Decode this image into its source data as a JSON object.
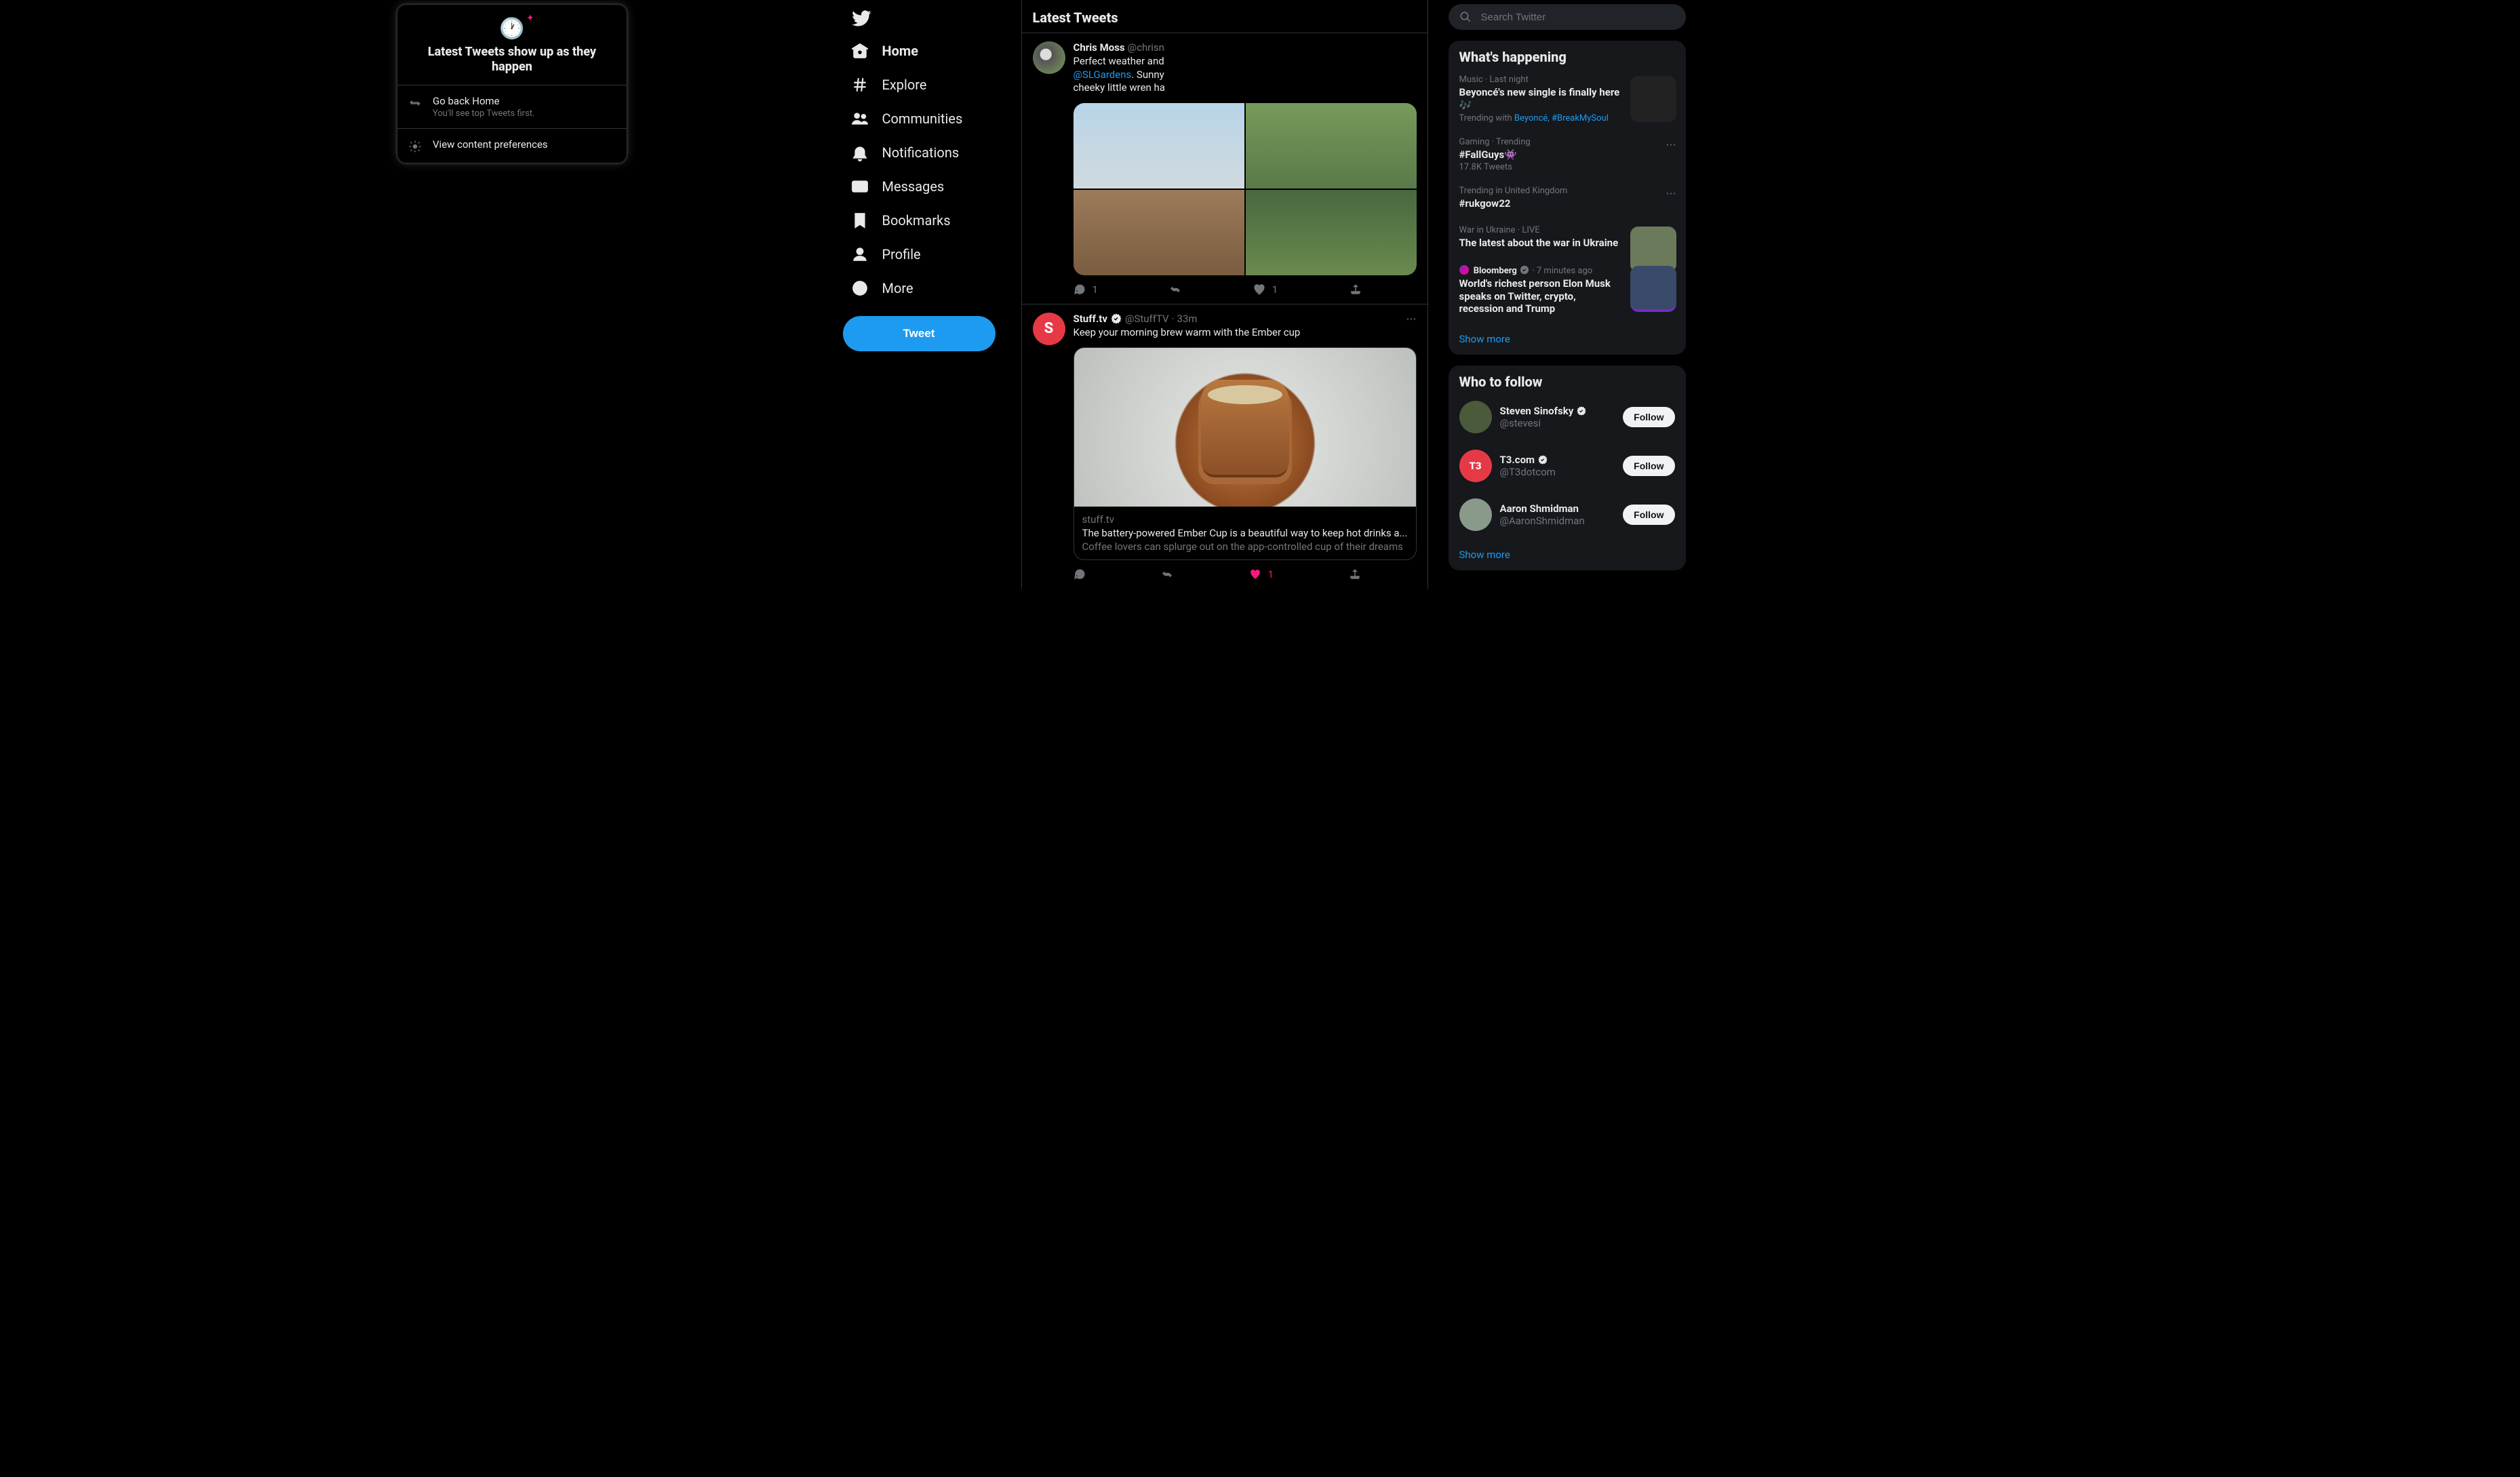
{
  "nav": {
    "items": [
      {
        "label": "Home"
      },
      {
        "label": "Explore"
      },
      {
        "label": "Communities"
      },
      {
        "label": "Notifications"
      },
      {
        "label": "Messages"
      },
      {
        "label": "Bookmarks"
      },
      {
        "label": "Profile"
      },
      {
        "label": "More"
      }
    ],
    "tweet_btn": "Tweet"
  },
  "timeline": {
    "header": "Latest Tweets",
    "tweets": [
      {
        "author": "Chris Moss",
        "handle": "@chrisn",
        "text_pre": "Perfect weather and",
        "mention": "@SLGardens",
        "text_post": ". Sunny",
        "text_line3": "cheeky little wren ha",
        "reply_count": "1",
        "like_count": "1"
      },
      {
        "author": "Stuff.tv",
        "handle": "@StuffTV",
        "time": "33m",
        "text": "Keep your morning brew warm with the Ember cup",
        "card_domain": "stuff.tv",
        "card_title": "The battery-powered Ember Cup is a beautiful way to keep hot drinks a...",
        "card_desc": "Coffee lovers can splurge out on the app-controlled cup of their dreams",
        "like_count": "1"
      }
    ]
  },
  "popover": {
    "title": "Latest Tweets show up as they happen",
    "go_back_title": "Go back Home",
    "go_back_sub": "You'll see top Tweets first.",
    "prefs": "View content preferences"
  },
  "search": {
    "placeholder": "Search Twitter"
  },
  "happening": {
    "header": "What's happening",
    "trends": [
      {
        "meta": "Music · Last night",
        "title": "Beyoncé's new single is finally here 🎶",
        "sub_pre": "Trending with",
        "sub_links": "Beyoncé, #BreakMySoul"
      },
      {
        "meta": "Gaming · Trending",
        "title": "#FallGuys👾",
        "sub": "17.8K Tweets"
      },
      {
        "meta": "Trending in United Kingdom",
        "title": "#rukgow22"
      },
      {
        "meta": "War in Ukraine · LIVE",
        "title": "The latest about the war in Ukraine"
      },
      {
        "source": "Bloomberg",
        "time": "7 minutes ago",
        "title": "World's richest person Elon Musk speaks on Twitter, crypto, recession and Trump"
      }
    ],
    "show_more": "Show more"
  },
  "follow": {
    "header": "Who to follow",
    "suggestions": [
      {
        "name": "Steven Sinofsky",
        "handle": "@stevesi",
        "verified": true
      },
      {
        "name": "T3.com",
        "handle": "@T3dotcom",
        "verified": true
      },
      {
        "name": "Aaron Shmidman",
        "handle": "@AaronShmidman",
        "verified": false
      }
    ],
    "follow_btn": "Follow",
    "show_more": "Show more"
  },
  "colors": {
    "accent": "#1d9bf0"
  }
}
